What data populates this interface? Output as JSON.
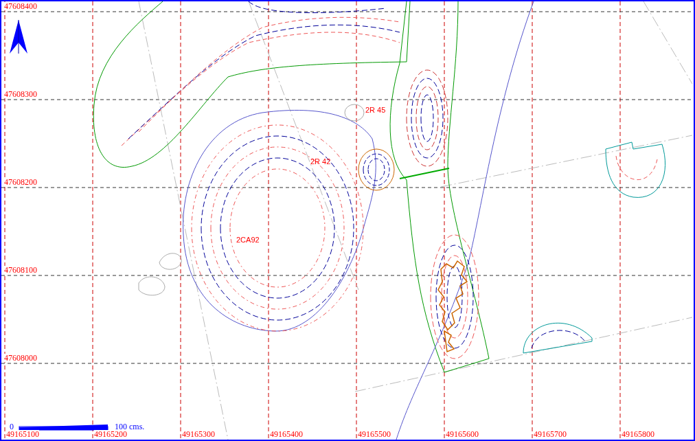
{
  "map": {
    "y_labels": [
      "47608400",
      "47608300",
      "47608200",
      "47608100",
      "47608000"
    ],
    "x_labels": [
      "49165100",
      "49165200",
      "49165300",
      "49165400",
      "49165500",
      "49165600",
      "49165700",
      "49165800"
    ],
    "feature_labels": [
      "2R 45",
      "2R 42",
      "2CA92"
    ],
    "scale_bar": {
      "start": "0",
      "end": "100 cms."
    }
  }
}
